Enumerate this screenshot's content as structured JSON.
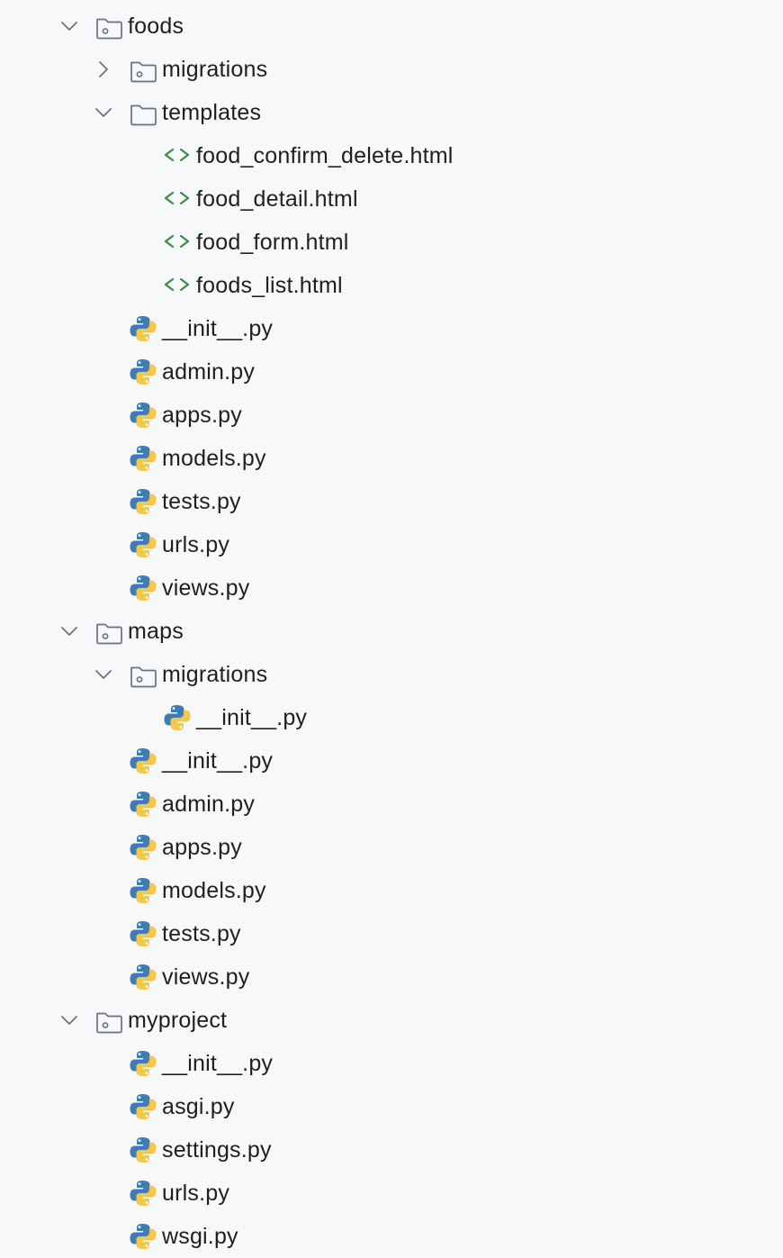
{
  "colors": {
    "background": "#f7f8fa",
    "text": "#1e1f22",
    "chevron": "#6f737a",
    "folder_outline": "#6c707e",
    "html_icon": "#3d8c40",
    "python_blue": "#3f7cb6",
    "python_yellow": "#f2c94c"
  },
  "tree": [
    {
      "label": "foods",
      "icon": "package-folder-icon",
      "chevron": "down",
      "depth": 0
    },
    {
      "label": "migrations",
      "icon": "package-folder-icon",
      "chevron": "right",
      "depth": 1
    },
    {
      "label": "templates",
      "icon": "folder-icon",
      "chevron": "down",
      "depth": 1
    },
    {
      "label": "food_confirm_delete.html",
      "icon": "html-file-icon",
      "chevron": "none",
      "depth": 2
    },
    {
      "label": "food_detail.html",
      "icon": "html-file-icon",
      "chevron": "none",
      "depth": 2
    },
    {
      "label": "food_form.html",
      "icon": "html-file-icon",
      "chevron": "none",
      "depth": 2
    },
    {
      "label": "foods_list.html",
      "icon": "html-file-icon",
      "chevron": "none",
      "depth": 2
    },
    {
      "label": "__init__.py",
      "icon": "python-file-icon",
      "chevron": "none",
      "depth": 1
    },
    {
      "label": "admin.py",
      "icon": "python-file-icon",
      "chevron": "none",
      "depth": 1
    },
    {
      "label": "apps.py",
      "icon": "python-file-icon",
      "chevron": "none",
      "depth": 1
    },
    {
      "label": "models.py",
      "icon": "python-file-icon",
      "chevron": "none",
      "depth": 1
    },
    {
      "label": "tests.py",
      "icon": "python-file-icon",
      "chevron": "none",
      "depth": 1
    },
    {
      "label": "urls.py",
      "icon": "python-file-icon",
      "chevron": "none",
      "depth": 1
    },
    {
      "label": "views.py",
      "icon": "python-file-icon",
      "chevron": "none",
      "depth": 1
    },
    {
      "label": "maps",
      "icon": "package-folder-icon",
      "chevron": "down",
      "depth": 0
    },
    {
      "label": "migrations",
      "icon": "package-folder-icon",
      "chevron": "down",
      "depth": 1
    },
    {
      "label": "__init__.py",
      "icon": "python-file-icon",
      "chevron": "none",
      "depth": 2
    },
    {
      "label": "__init__.py",
      "icon": "python-file-icon",
      "chevron": "none",
      "depth": 1
    },
    {
      "label": "admin.py",
      "icon": "python-file-icon",
      "chevron": "none",
      "depth": 1
    },
    {
      "label": "apps.py",
      "icon": "python-file-icon",
      "chevron": "none",
      "depth": 1
    },
    {
      "label": "models.py",
      "icon": "python-file-icon",
      "chevron": "none",
      "depth": 1
    },
    {
      "label": "tests.py",
      "icon": "python-file-icon",
      "chevron": "none",
      "depth": 1
    },
    {
      "label": "views.py",
      "icon": "python-file-icon",
      "chevron": "none",
      "depth": 1
    },
    {
      "label": "myproject",
      "icon": "package-folder-icon",
      "chevron": "down",
      "depth": 0
    },
    {
      "label": "__init__.py",
      "icon": "python-file-icon",
      "chevron": "none",
      "depth": 1
    },
    {
      "label": "asgi.py",
      "icon": "python-file-icon",
      "chevron": "none",
      "depth": 1
    },
    {
      "label": "settings.py",
      "icon": "python-file-icon",
      "chevron": "none",
      "depth": 1
    },
    {
      "label": "urls.py",
      "icon": "python-file-icon",
      "chevron": "none",
      "depth": 1
    },
    {
      "label": "wsgi.py",
      "icon": "python-file-icon",
      "chevron": "none",
      "depth": 1
    }
  ]
}
